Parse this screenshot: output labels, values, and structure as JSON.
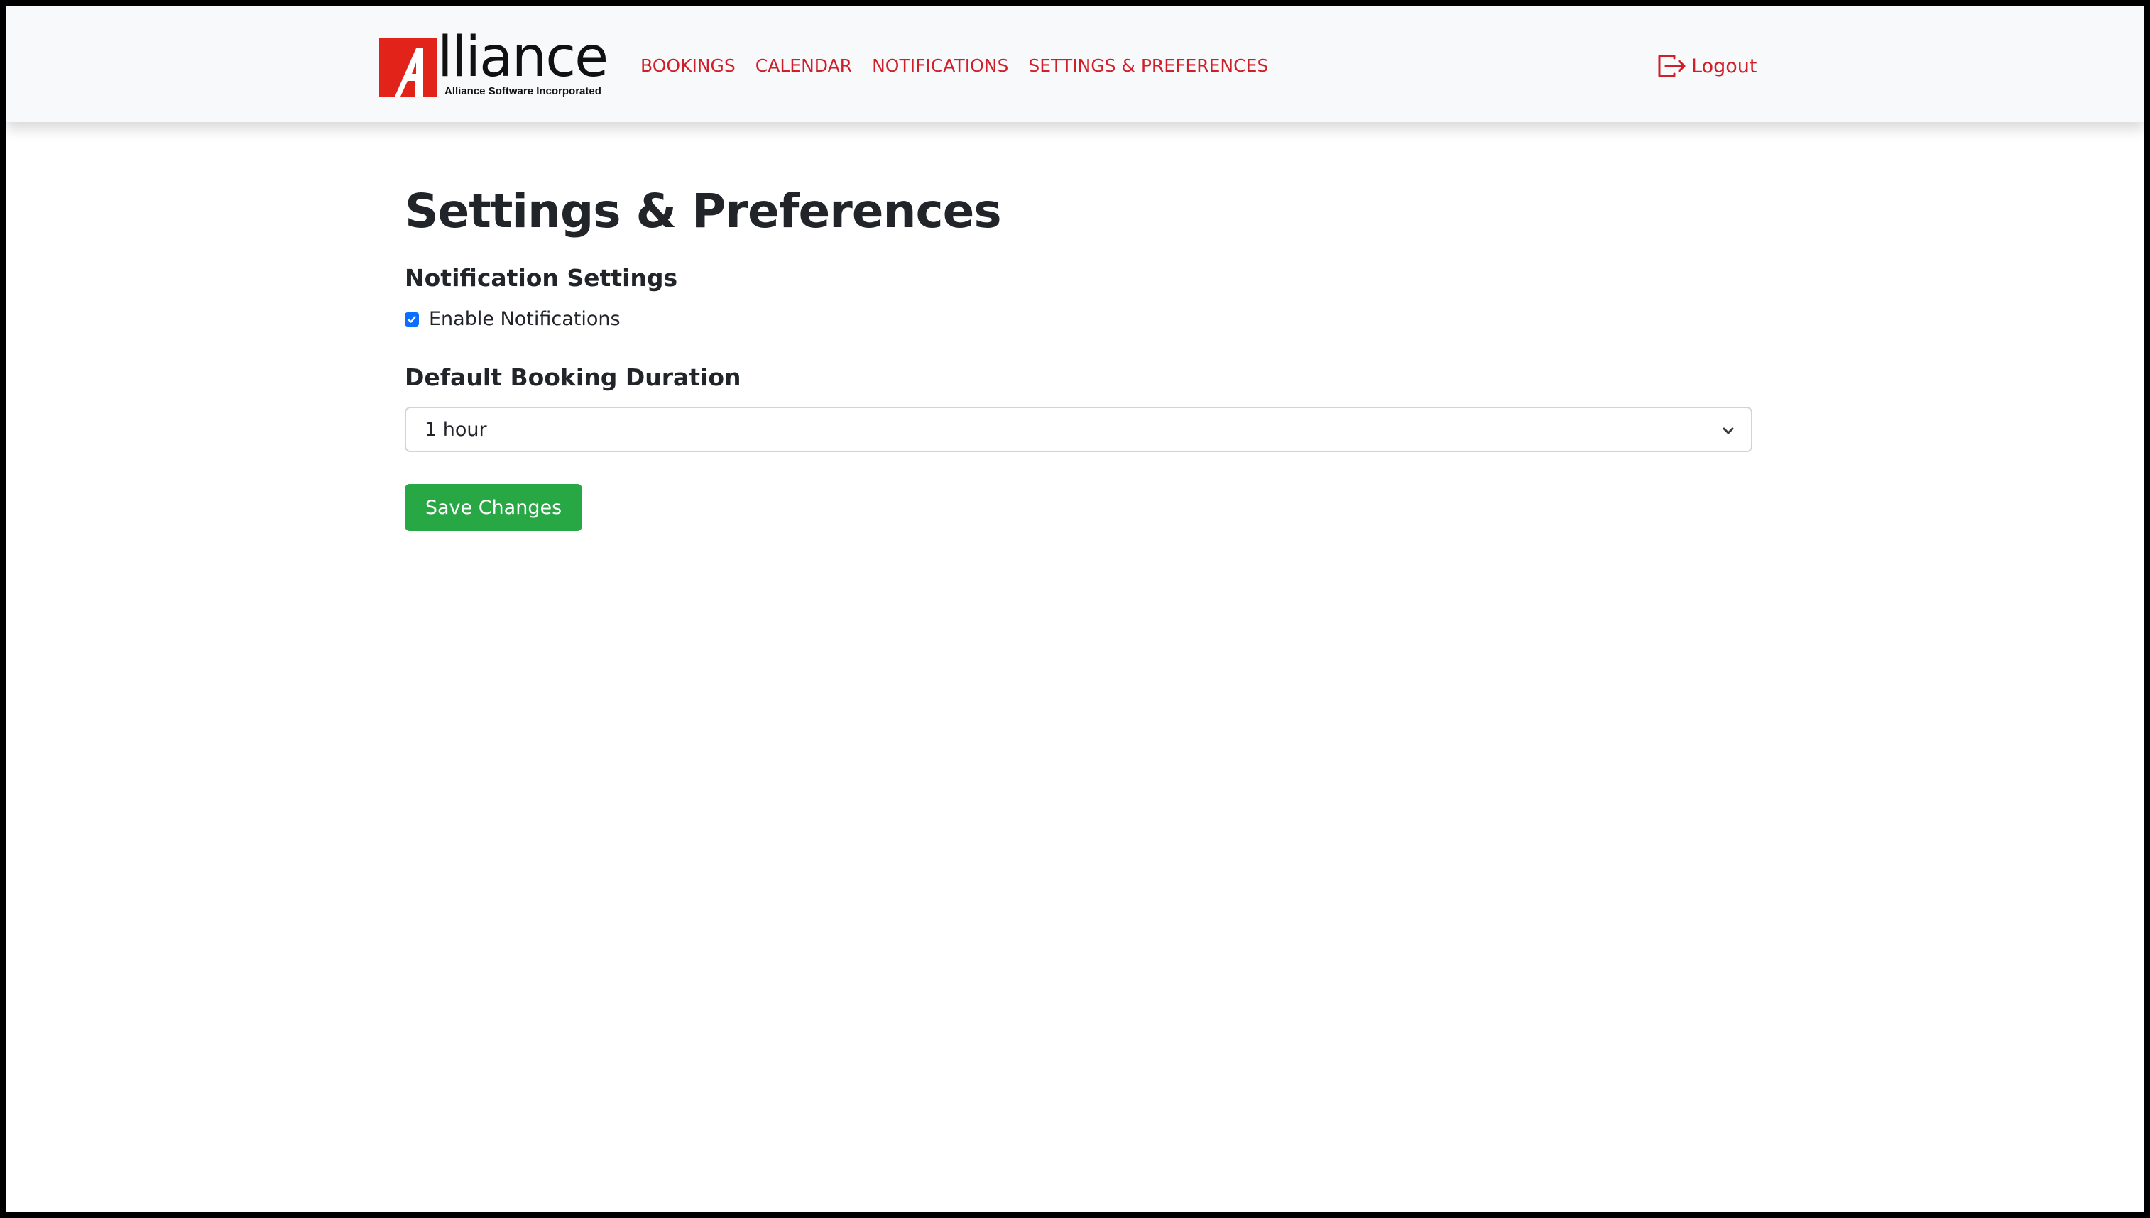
{
  "brand": {
    "name": "lliance",
    "tagline": "Alliance Software Incorporated",
    "accent_color": "#e2231a"
  },
  "nav": {
    "items": [
      {
        "label": "BOOKINGS"
      },
      {
        "label": "CALENDAR"
      },
      {
        "label": "NOTIFICATIONS"
      },
      {
        "label": "SETTINGS & PREFERENCES"
      }
    ],
    "link_color": "#d11f2a",
    "logout_label": "Logout",
    "logout_icon": "logout-icon"
  },
  "main": {
    "title": "Settings & Preferences",
    "notification_section": {
      "heading": "Notification Settings",
      "checkbox_label": "Enable Notifications",
      "checked": true
    },
    "duration_section": {
      "heading": "Default Booking Duration",
      "selected": "1 hour"
    },
    "save_label": "Save Changes",
    "save_color": "#28a745"
  }
}
